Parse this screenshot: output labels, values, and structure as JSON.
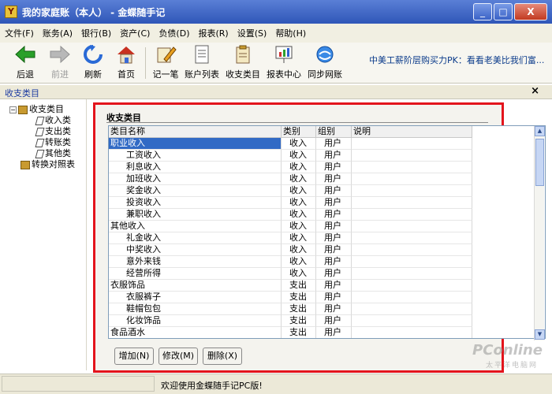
{
  "window": {
    "app_icon": "Y",
    "title": "我的家庭账（本人） - 金蝶随手记",
    "minimize": "_",
    "maximize": "□",
    "close": "X"
  },
  "menu": [
    "文件(F)",
    "账务(A)",
    "银行(B)",
    "资产(C)",
    "负债(D)",
    "报表(R)",
    "设置(S)",
    "帮助(H)"
  ],
  "toolbar": {
    "back": "后退",
    "forward": "前进",
    "refresh": "刷新",
    "home": "首页",
    "record": "记一笔",
    "accounts": "账户列表",
    "categories": "收支类目",
    "reports": "报表中心",
    "sync": "同步网账",
    "marquee": "中美工薪阶层购买力PK：看看老美比我们富..."
  },
  "navbar": {
    "title": "收支类目",
    "close": "×"
  },
  "tree": {
    "root": "收支类目",
    "children": [
      "收入类",
      "支出类",
      "转账类",
      "其他类"
    ],
    "other": "转换对照表"
  },
  "panel": {
    "title": "收支类目",
    "columns": [
      "类目名称",
      "类别",
      "组别",
      "说明"
    ],
    "rows": [
      {
        "name": "职业收入",
        "type": "收入",
        "group": "用户",
        "note": ""
      },
      {
        "name": "工资收入",
        "type": "收入",
        "group": "用户",
        "note": ""
      },
      {
        "name": "利息收入",
        "type": "收入",
        "group": "用户",
        "note": ""
      },
      {
        "name": "加班收入",
        "type": "收入",
        "group": "用户",
        "note": ""
      },
      {
        "name": "奖金收入",
        "type": "收入",
        "group": "用户",
        "note": ""
      },
      {
        "name": "投资收入",
        "type": "收入",
        "group": "用户",
        "note": ""
      },
      {
        "name": "兼职收入",
        "type": "收入",
        "group": "用户",
        "note": ""
      },
      {
        "name": "其他收入",
        "type": "收入",
        "group": "用户",
        "note": ""
      },
      {
        "name": "礼金收入",
        "type": "收入",
        "group": "用户",
        "note": ""
      },
      {
        "name": "中奖收入",
        "type": "收入",
        "group": "用户",
        "note": ""
      },
      {
        "name": "意外来钱",
        "type": "收入",
        "group": "用户",
        "note": ""
      },
      {
        "name": "经营所得",
        "type": "收入",
        "group": "用户",
        "note": ""
      },
      {
        "name": "衣服饰品",
        "type": "支出",
        "group": "用户",
        "note": ""
      },
      {
        "name": "衣服裤子",
        "type": "支出",
        "group": "用户",
        "note": ""
      },
      {
        "name": "鞋帽包包",
        "type": "支出",
        "group": "用户",
        "note": ""
      },
      {
        "name": "化妆饰品",
        "type": "支出",
        "group": "用户",
        "note": ""
      },
      {
        "name": "食品酒水",
        "type": "支出",
        "group": "用户",
        "note": ""
      }
    ],
    "buttons": {
      "add": "增加(N)",
      "edit": "修改(M)",
      "delete": "删除(X)"
    }
  },
  "status": {
    "message": "欢迎使用金蝶随手记PC版!"
  },
  "watermark": {
    "brand": "PConline",
    "sub": "太平洋电脑网"
  }
}
